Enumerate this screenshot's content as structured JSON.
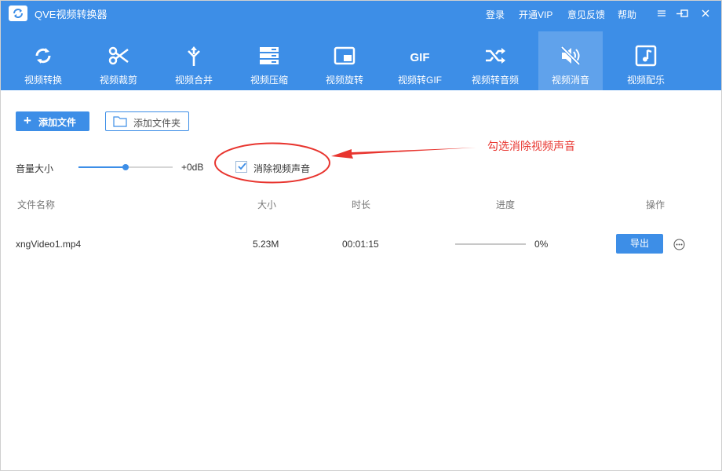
{
  "app": {
    "title": "QVE视频转换器",
    "links": [
      "登录",
      "开通VIP",
      "意见反馈",
      "帮助"
    ],
    "window_controls": [
      "menu-icon",
      "minimize-icon",
      "maximize-icon",
      "close-icon"
    ]
  },
  "toolbar": {
    "tools": [
      {
        "label": "视频转换",
        "icon": "refresh-icon"
      },
      {
        "label": "视频裁剪",
        "icon": "scissors-icon"
      },
      {
        "label": "视频合并",
        "icon": "merge-icon"
      },
      {
        "label": "视频压缩",
        "icon": "compress-icon"
      },
      {
        "label": "视频旋转",
        "icon": "rotate-icon"
      },
      {
        "label": "视频转GIF",
        "icon": "gif-icon"
      },
      {
        "label": "视频转音频",
        "icon": "shuffle-icon"
      },
      {
        "label": "视频消音",
        "icon": "mute-icon"
      },
      {
        "label": "视频配乐",
        "icon": "music-icon"
      }
    ],
    "active_index": 7,
    "gif_glyph": "GIF"
  },
  "actions": {
    "add_file": "添加文件",
    "add_folder": "添加文件夹"
  },
  "volume": {
    "label": "音量大小",
    "value": "+0dB",
    "slider_fraction": 0.5
  },
  "mute": {
    "label": "消除视频声音",
    "checked": true
  },
  "annotation": {
    "text": "勾选消除视频声音",
    "color": "#e8352f"
  },
  "table": {
    "headers": [
      "文件名称",
      "大小",
      "时长",
      "进度",
      "操作"
    ],
    "rows": [
      {
        "name": "xngVideo1.mp4",
        "size": "5.23M",
        "duration": "00:01:15",
        "progress": "0%",
        "progress_fraction": 0,
        "export": "导出"
      }
    ]
  },
  "colors": {
    "accent": "#3d8ee7",
    "annotation": "#e8352f"
  }
}
